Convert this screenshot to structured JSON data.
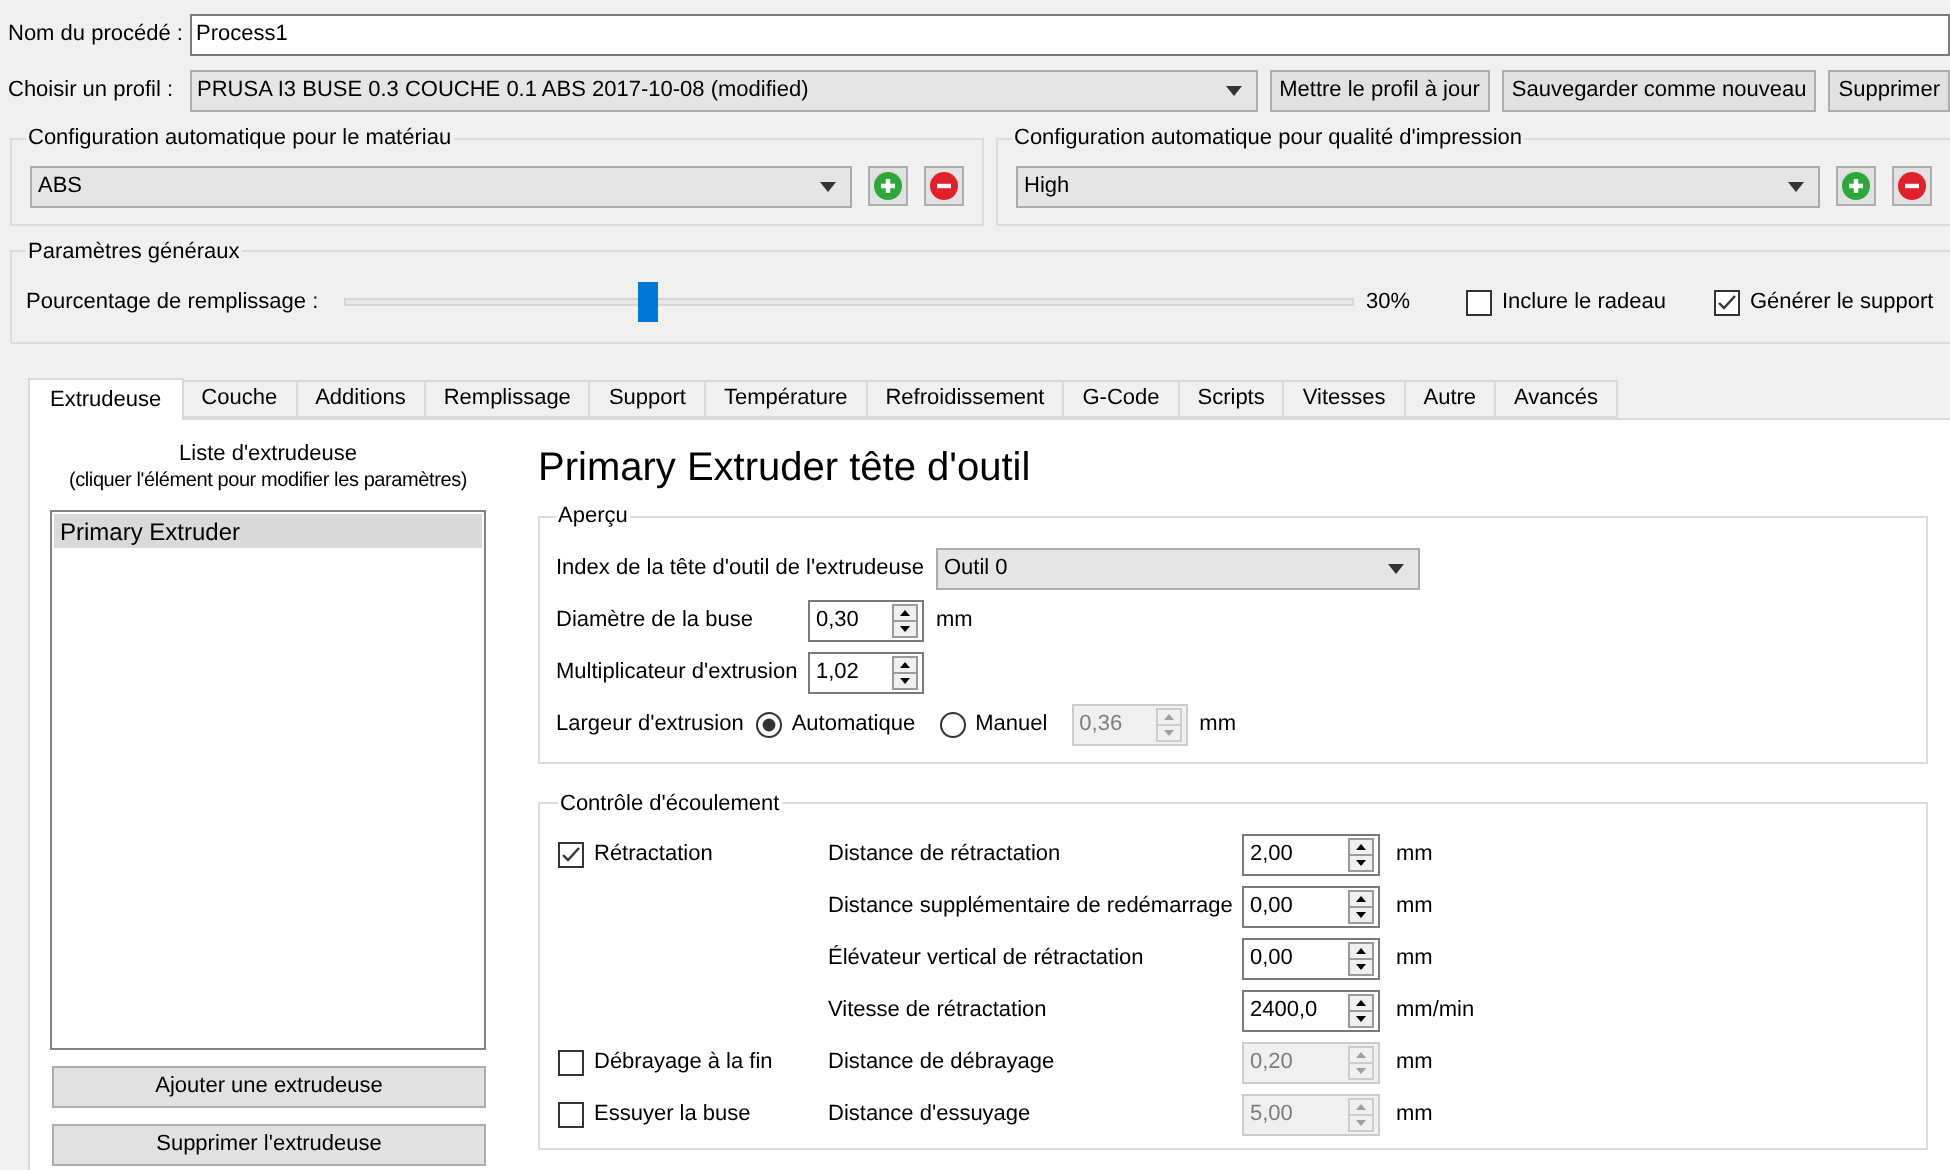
{
  "process_name": {
    "label": "Nom du procédé :",
    "value": "Process1"
  },
  "profile": {
    "label": "Choisir un profil :",
    "value": "PRUSA I3 BUSE 0.3 COUCHE 0.1 ABS 2017-10-08 (modified)",
    "buttons": [
      "Mettre le profil à jour",
      "Sauvegarder comme nouveau",
      "Supprimer"
    ]
  },
  "auto_configs": [
    {
      "title": "Configuration automatique pour le matériau",
      "value": "ABS"
    },
    {
      "title": "Configuration automatique pour qualité d'impression",
      "value": "High"
    }
  ],
  "general": {
    "title": "Paramètres généraux",
    "infill_label": "Pourcentage de remplissage :",
    "infill": {
      "level": 0.3
    },
    "infill_reading": "30%",
    "checkboxes": [
      {
        "label": "Inclure le radeau",
        "checked": false
      },
      {
        "label": "Générer le support",
        "checked": true
      }
    ]
  },
  "tabs": [
    {
      "label": "Extrudeuse",
      "selected": true
    },
    {
      "label": "Couche",
      "selected": false
    },
    {
      "label": "Additions",
      "selected": false
    },
    {
      "label": "Remplissage",
      "selected": false
    },
    {
      "label": "Support",
      "selected": false
    },
    {
      "label": "Température",
      "selected": false
    },
    {
      "label": "Refroidissement",
      "selected": false
    },
    {
      "label": "G-Code",
      "selected": false
    },
    {
      "label": "Scripts",
      "selected": false
    },
    {
      "label": "Vitesses",
      "selected": false
    },
    {
      "label": "Autre",
      "selected": false
    },
    {
      "label": "Avancés",
      "selected": false
    }
  ],
  "extruder_list": {
    "title": "Liste d'extrudeuse",
    "hint": "(cliquer l'élément pour modifier les paramètres)",
    "items": [
      {
        "label": "Primary Extruder",
        "selected": true
      }
    ],
    "buttons": [
      "Ajouter une extrudeuse",
      "Supprimer l'extrudeuse"
    ]
  },
  "heading": "Primary Extruder tête d'outil",
  "overview": {
    "title": "Aperçu",
    "tool_index": {
      "label": "Index de la tête d'outil de l'extrudeuse",
      "value": "Outil 0"
    },
    "fields": [
      {
        "label": "Diamètre de la buse",
        "value": "0,30",
        "unit": "mm",
        "disabled": false
      },
      {
        "label": "Multiplicateur d'extrusion",
        "value": "1,02",
        "disabled": false
      }
    ],
    "width": {
      "label": "Largeur d'extrusion",
      "options": [
        {
          "label": "Automatique",
          "selected": true
        },
        {
          "label": "Manuel",
          "selected": false
        }
      ],
      "value": "0,36",
      "unit": "mm",
      "disabled": true
    }
  },
  "flow": {
    "title": "Contrôle d'écoulement",
    "rows": [
      {
        "check": {
          "label": "Rétractation",
          "checked": true
        },
        "label": "Distance de rétractation",
        "value": "2,00",
        "unit": "mm",
        "disabled": false
      },
      {
        "label": "Distance supplémentaire de redémarrage",
        "value": "0,00",
        "unit": "mm",
        "disabled": false
      },
      {
        "label": "Élévateur vertical de rétractation",
        "value": "0,00",
        "unit": "mm",
        "disabled": false
      },
      {
        "label": "Vitesse de rétractation",
        "value": "2400,0",
        "unit": "mm/min",
        "disabled": false
      },
      {
        "check": {
          "label": "Débrayage à la fin",
          "checked": false
        },
        "label": "Distance de débrayage",
        "value": "0,20",
        "unit": "mm",
        "disabled": true
      },
      {
        "check": {
          "label": "Essuyer la buse",
          "checked": false
        },
        "label": "Distance d'essuyage",
        "value": "5,00",
        "unit": "mm",
        "disabled": true
      }
    ]
  }
}
